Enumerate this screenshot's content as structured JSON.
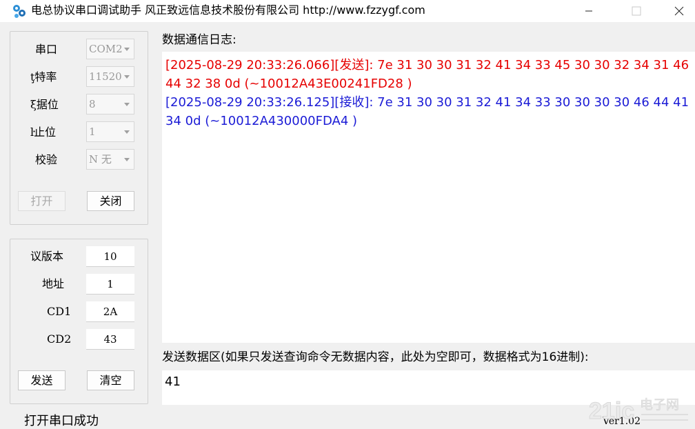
{
  "window": {
    "title": "电总协议串口调试助手 风正致远信息技术股份有限公司 http://www.fzzygf.com",
    "icon": "gears-icon"
  },
  "serial": {
    "port_label": "串口",
    "port_value": "COM2",
    "baud_label": "ţ特率",
    "baud_value": "11520",
    "databits_label": "ξ据位",
    "databits_value": "8",
    "stopbits_label": "ŀ止位",
    "stopbits_value": "1",
    "parity_label": "校验",
    "parity_value": "N 无",
    "open_label": "打开",
    "close_label": "关闭"
  },
  "protocol": {
    "version_label": "议版本",
    "version_value": "10",
    "address_label": "地址",
    "address_value": "1",
    "cd1_label": "CD1",
    "cd1_value": "2A",
    "cd2_label": "CD2",
    "cd2_value": "43",
    "send_label": "发送",
    "clear_label": "清空"
  },
  "log": {
    "heading": "数据通信日志:",
    "entries": [
      {
        "kind": "send",
        "text": "[2025-08-29 20:33:26.066][发送]: 7e 31 30 30 31 32 41 34 33 45 30 30 32 34 31 46 44 32 38 0d (~10012A43E00241FD28 )",
        "color": "#e60000"
      },
      {
        "kind": "recv",
        "text": "[2025-08-29 20:33:26.125][接收]: 7e 31 30 30 31 32 41 34 33 30 30 30 30 46 44 41 34 0d (~10012A430000FDA4 )",
        "color": "#1b1bd6"
      }
    ]
  },
  "send_area": {
    "heading": "发送数据区(如果只发送查询命令无数据内容，此处为空即可，数据格式为16进制):",
    "value": "41"
  },
  "status": {
    "text": "打开串口成功",
    "version": "Ver1.02"
  },
  "watermark": {
    "brand": "21ic",
    "cn": "电子网"
  }
}
